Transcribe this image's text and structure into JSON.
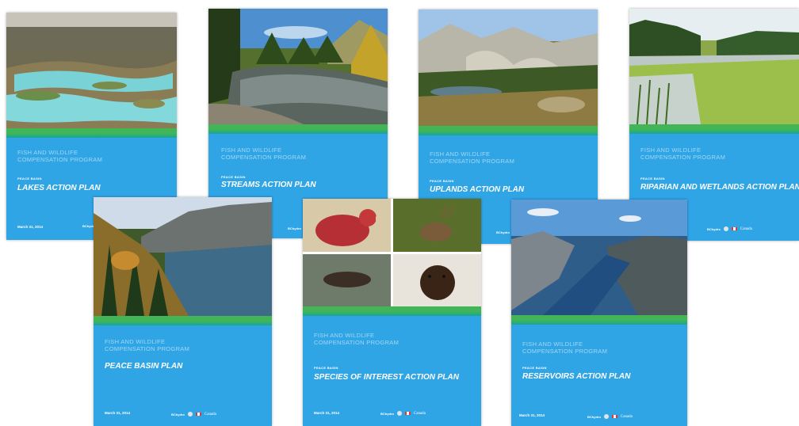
{
  "program_name": "FISH AND WILDLIFE\nCOMPENSATION PROGRAM",
  "basin_label": "PEACE BASIN",
  "date": "March 31, 2014",
  "bchydro": "BChydro",
  "canada": "Canada",
  "covers": [
    {
      "id": "lakes",
      "title": "LAKES ACTION PLAN",
      "photo": "lakes-landscape"
    },
    {
      "id": "streams",
      "title": "STREAMS ACTION PLAN",
      "photo": "river-forest"
    },
    {
      "id": "uplands",
      "title": "UPLANDS ACTION PLAN",
      "photo": "alpine-meadow"
    },
    {
      "id": "riparian",
      "title": "RIPARIAN AND WETLANDS ACTION PLAN",
      "photo": "wetland-reeds"
    },
    {
      "id": "peace",
      "title": "PEACE BASIN PLAN",
      "photo": "mountain-lake-autumn"
    },
    {
      "id": "species",
      "title": "SPECIES OF INTEREST ACTION PLAN",
      "photo": "wildlife-collage"
    },
    {
      "id": "reservoirs",
      "title": "RESERVOIRS ACTION PLAN",
      "photo": "reservoir-aerial"
    }
  ],
  "colors": {
    "cover_blue": "#2fa5e6",
    "stripe_green": "#42b656",
    "stripe_teal": "#1aa596"
  }
}
